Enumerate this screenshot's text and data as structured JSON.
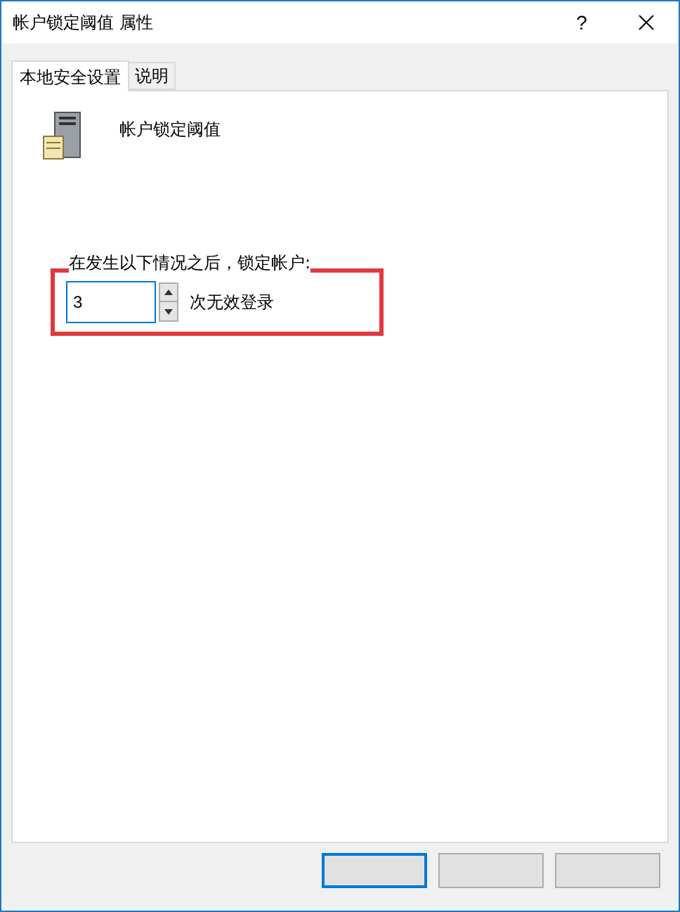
{
  "window": {
    "title": "帐户锁定阈值 属性",
    "help": "?"
  },
  "tabs": [
    {
      "label": "本地安全设置",
      "selected": true
    },
    {
      "label": "说明",
      "selected": false
    }
  ],
  "policy": {
    "name": "帐户锁定阈值"
  },
  "setting": {
    "prompt": "在发生以下情况之后，锁定帐户:",
    "value": "3",
    "unit": "次无效登录",
    "highlighted": true
  },
  "buttons": [
    {
      "default": true
    },
    {
      "default": false
    },
    {
      "default": false
    }
  ]
}
